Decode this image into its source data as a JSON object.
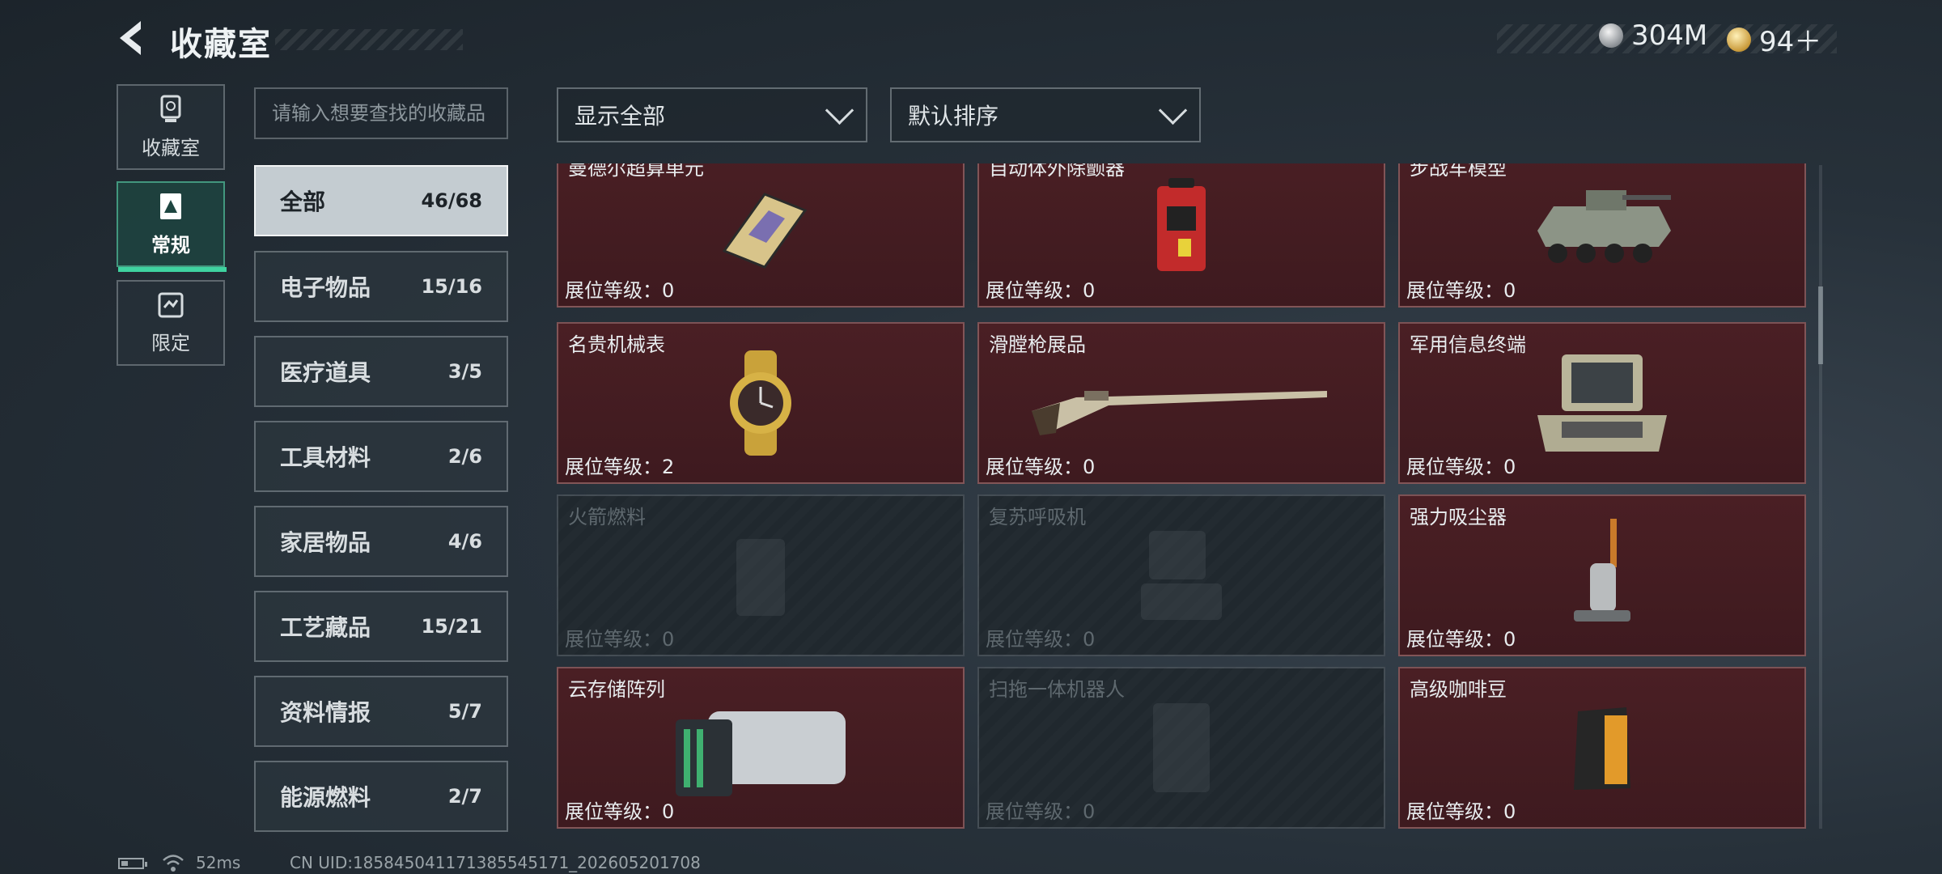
{
  "header": {
    "title": "收藏室",
    "currency_silver": "304M",
    "currency_gold": "94＋"
  },
  "nav": [
    {
      "label": "收藏室",
      "icon": "trophy-icon"
    },
    {
      "label": "常规",
      "icon": "collection-icon",
      "active": true
    },
    {
      "label": "限定",
      "icon": "limited-icon"
    }
  ],
  "search": {
    "placeholder": "请输入想要查找的收藏品"
  },
  "categories": [
    {
      "name": "全部",
      "count": "46/68",
      "active": true
    },
    {
      "name": "电子物品",
      "count": "15/16"
    },
    {
      "name": "医疗道具",
      "count": "3/5"
    },
    {
      "name": "工具材料",
      "count": "2/6"
    },
    {
      "name": "家居物品",
      "count": "4/6"
    },
    {
      "name": "工艺藏品",
      "count": "15/21"
    },
    {
      "name": "资料情报",
      "count": "5/7"
    },
    {
      "name": "能源燃料",
      "count": "2/7"
    }
  ],
  "filters": {
    "display": "显示全部",
    "sort": "默认排序"
  },
  "items": [
    {
      "name": "曼德尔超算单元",
      "level": "展位等级：0",
      "locked": false
    },
    {
      "name": "自动体外除颤器",
      "level": "展位等级：0",
      "locked": false
    },
    {
      "name": "步战车模型",
      "level": "展位等级：0",
      "locked": false
    },
    {
      "name": "名贵机械表",
      "level": "展位等级：2",
      "locked": false
    },
    {
      "name": "滑膛枪展品",
      "level": "展位等级：0",
      "locked": false
    },
    {
      "name": "军用信息终端",
      "level": "展位等级：0",
      "locked": false
    },
    {
      "name": "火箭燃料",
      "level": "展位等级：0",
      "locked": true
    },
    {
      "name": "复苏呼吸机",
      "level": "展位等级：0",
      "locked": true
    },
    {
      "name": "强力吸尘器",
      "level": "展位等级：0",
      "locked": false
    },
    {
      "name": "云存储阵列",
      "level": "展位等级：0",
      "locked": false
    },
    {
      "name": "扫拖一体机器人",
      "level": "展位等级：0",
      "locked": true
    },
    {
      "name": "高级咖啡豆",
      "level": "展位等级：0",
      "locked": false
    }
  ],
  "footer": {
    "ping": "52ms",
    "uid": "CN UID:18584504117138554517​1_202605201708"
  },
  "colors": {
    "accent": "#3fd3a0",
    "card_bg": "#4a1f24",
    "active_cat_bg": "#d2dade"
  }
}
